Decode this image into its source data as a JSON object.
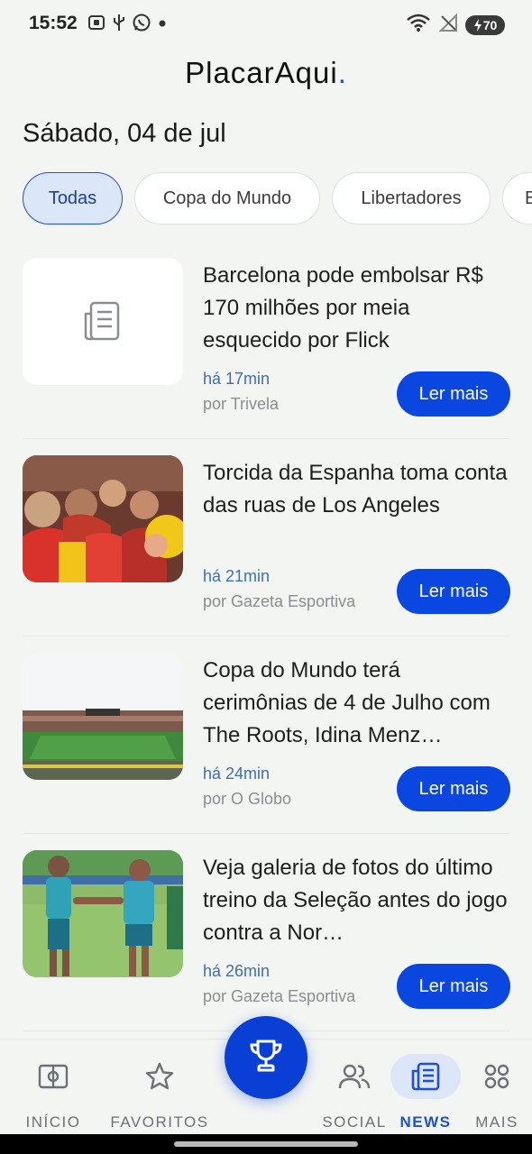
{
  "status_bar": {
    "time": "15:52",
    "left_icons": [
      "screenshot-icon",
      "usb-icon",
      "whatsapp-icon",
      "dot-icon"
    ],
    "right_icons": [
      "wifi-icon",
      "no-signal-icon",
      "battery-icon"
    ],
    "battery_level": "70"
  },
  "app": {
    "name": "PlacarAqui",
    "name_dot": ".",
    "accent_color": "#1e4fd8"
  },
  "date": "Sábado, 04 de jul",
  "filters": [
    {
      "label": "Todas",
      "selected": true
    },
    {
      "label": "Copa do Mundo",
      "selected": false
    },
    {
      "label": "Libertadores",
      "selected": false
    },
    {
      "label": "B",
      "selected": false
    }
  ],
  "news": [
    {
      "headline": "Barcelona pode embolsar R$ 170 milhões por meia esquecido por Flick",
      "time_ago": "há 17min",
      "source": "por Trivela",
      "image": "placeholder-news-icon",
      "button": "Ler mais"
    },
    {
      "headline": "Torcida da Espanha toma conta das ruas de Los Angeles",
      "time_ago": "há 21min",
      "source": "por Gazeta Esportiva",
      "image": "spain-fans-photo",
      "button": "Ler mais"
    },
    {
      "headline": "Copa do Mundo terá cerimônias de 4 de Julho com The Roots, Idina Menz…",
      "time_ago": "há 24min",
      "source": "por O Globo",
      "image": "stadium-photo",
      "button": "Ler mais"
    },
    {
      "headline": "Veja galeria de fotos do último treino da Seleção antes do jogo contra a Nor…",
      "time_ago": "há 26min",
      "source": "por Gazeta Esportiva",
      "image": "training-photo",
      "button": "Ler mais"
    }
  ],
  "bottom_nav": {
    "items": [
      {
        "label": "INÍCIO",
        "icon": "pitch-icon"
      },
      {
        "label": "FAVORITOS",
        "icon": "star-icon"
      },
      {
        "label": "SOCIAL",
        "icon": "people-icon"
      },
      {
        "label": "NEWS",
        "icon": "newspaper-icon",
        "active": true
      },
      {
        "label": "MAIS",
        "icon": "grid-dots-icon"
      }
    ],
    "fab_icon": "trophy-icon"
  }
}
